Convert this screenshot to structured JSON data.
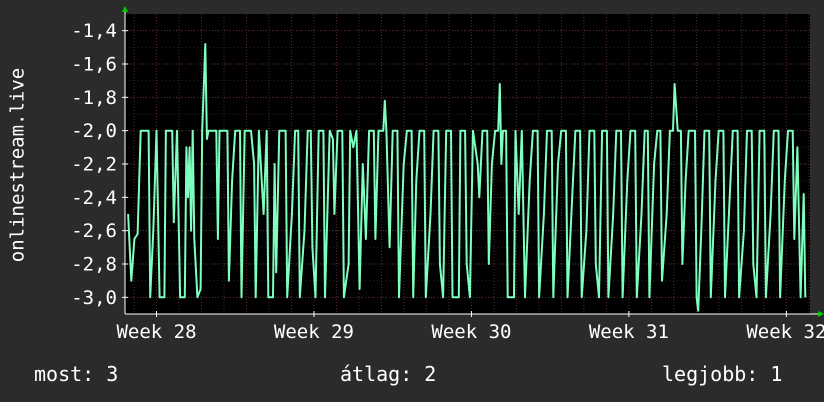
{
  "chart_data": {
    "type": "line",
    "ylabel": "onlinestream.live",
    "xlabel": "",
    "title": "",
    "y_ticks": [
      "-1,4",
      "-1,6",
      "-1,8",
      "-2,0",
      "-2,2",
      "-2,4",
      "-2,6",
      "-2,8",
      "-3,0"
    ],
    "y_tick_values": [
      -1.4,
      -1.6,
      -1.8,
      -2.0,
      -2.2,
      -2.4,
      -2.6,
      -2.8,
      -3.0
    ],
    "x_ticks": [
      "Week 28",
      "Week 29",
      "Week 30",
      "Week 31",
      "Week 32"
    ],
    "x_tick_values": [
      28,
      29,
      30,
      31,
      32
    ],
    "ylim": [
      -3.1,
      -1.3
    ],
    "xlim": [
      27.8,
      32.15
    ],
    "grid": true,
    "series": [
      {
        "color": "#7fffbf",
        "points": [
          [
            27.82,
            -2.5
          ],
          [
            27.84,
            -2.9
          ],
          [
            27.86,
            -2.65
          ],
          [
            27.88,
            -2.62
          ],
          [
            27.9,
            -2.0
          ],
          [
            27.95,
            -2.0
          ],
          [
            27.96,
            -3.0
          ],
          [
            27.98,
            -2.6
          ],
          [
            28.0,
            -2.0
          ],
          [
            28.02,
            -3.0
          ],
          [
            28.05,
            -3.0
          ],
          [
            28.06,
            -2.0
          ],
          [
            28.1,
            -2.0
          ],
          [
            28.11,
            -2.55
          ],
          [
            28.13,
            -2.0
          ],
          [
            28.15,
            -3.0
          ],
          [
            28.18,
            -3.0
          ],
          [
            28.19,
            -2.1
          ],
          [
            28.2,
            -2.4
          ],
          [
            28.21,
            -2.1
          ],
          [
            28.22,
            -2.6
          ],
          [
            28.23,
            -2.0
          ],
          [
            28.24,
            -2.65
          ],
          [
            28.26,
            -3.0
          ],
          [
            28.28,
            -2.95
          ],
          [
            28.29,
            -2.0
          ],
          [
            28.3,
            -1.75
          ],
          [
            28.31,
            -1.48
          ],
          [
            28.32,
            -2.05
          ],
          [
            28.33,
            -2.0
          ],
          [
            28.38,
            -2.0
          ],
          [
            28.39,
            -2.65
          ],
          [
            28.4,
            -2.0
          ],
          [
            28.45,
            -2.0
          ],
          [
            28.46,
            -2.9
          ],
          [
            28.48,
            -2.3
          ],
          [
            28.5,
            -2.0
          ],
          [
            28.53,
            -2.0
          ],
          [
            28.54,
            -3.0
          ],
          [
            28.56,
            -2.0
          ],
          [
            28.6,
            -2.0
          ],
          [
            28.62,
            -2.2
          ],
          [
            28.63,
            -3.0
          ],
          [
            28.65,
            -2.0
          ],
          [
            28.68,
            -2.5
          ],
          [
            28.7,
            -2.0
          ],
          [
            28.71,
            -3.0
          ],
          [
            28.74,
            -3.0
          ],
          [
            28.75,
            -2.2
          ],
          [
            28.76,
            -2.85
          ],
          [
            28.78,
            -2.0
          ],
          [
            28.82,
            -2.0
          ],
          [
            28.83,
            -3.0
          ],
          [
            28.86,
            -2.5
          ],
          [
            28.88,
            -2.0
          ],
          [
            28.9,
            -2.0
          ],
          [
            28.91,
            -3.0
          ],
          [
            28.94,
            -2.6
          ],
          [
            28.96,
            -2.0
          ],
          [
            28.98,
            -2.0
          ],
          [
            28.99,
            -2.7
          ],
          [
            29.01,
            -3.0
          ],
          [
            29.03,
            -2.0
          ],
          [
            29.06,
            -2.0
          ],
          [
            29.07,
            -3.0
          ],
          [
            29.1,
            -2.0
          ],
          [
            29.12,
            -2.05
          ],
          [
            29.13,
            -2.5
          ],
          [
            29.15,
            -2.0
          ],
          [
            29.18,
            -2.0
          ],
          [
            29.19,
            -3.0
          ],
          [
            29.22,
            -2.8
          ],
          [
            29.23,
            -2.0
          ],
          [
            29.25,
            -2.1
          ],
          [
            29.27,
            -2.0
          ],
          [
            29.29,
            -2.95
          ],
          [
            29.31,
            -2.2
          ],
          [
            29.33,
            -2.65
          ],
          [
            29.35,
            -2.0
          ],
          [
            29.38,
            -2.0
          ],
          [
            29.39,
            -2.65
          ],
          [
            29.41,
            -2.0
          ],
          [
            29.44,
            -2.0
          ],
          [
            29.45,
            -1.82
          ],
          [
            29.46,
            -2.0
          ],
          [
            29.48,
            -2.7
          ],
          [
            29.5,
            -2.0
          ],
          [
            29.53,
            -2.0
          ],
          [
            29.54,
            -3.0
          ],
          [
            29.57,
            -2.2
          ],
          [
            29.59,
            -2.0
          ],
          [
            29.62,
            -2.0
          ],
          [
            29.63,
            -3.0
          ],
          [
            29.65,
            -2.3
          ],
          [
            29.67,
            -2.0
          ],
          [
            29.7,
            -2.0
          ],
          [
            29.71,
            -3.0
          ],
          [
            29.74,
            -2.5
          ],
          [
            29.76,
            -2.0
          ],
          [
            29.79,
            -2.0
          ],
          [
            29.8,
            -2.8
          ],
          [
            29.82,
            -3.0
          ],
          [
            29.84,
            -2.0
          ],
          [
            29.87,
            -2.0
          ],
          [
            29.88,
            -3.0
          ],
          [
            29.92,
            -3.0
          ],
          [
            29.93,
            -2.0
          ],
          [
            29.96,
            -2.0
          ],
          [
            29.97,
            -2.8
          ],
          [
            29.99,
            -3.0
          ],
          [
            30.01,
            -2.0
          ],
          [
            30.04,
            -2.2
          ],
          [
            30.05,
            -2.4
          ],
          [
            30.07,
            -2.0
          ],
          [
            30.1,
            -2.0
          ],
          [
            30.11,
            -2.8
          ],
          [
            30.13,
            -2.2
          ],
          [
            30.15,
            -2.0
          ],
          [
            30.17,
            -2.0
          ],
          [
            30.18,
            -1.72
          ],
          [
            30.19,
            -2.2
          ],
          [
            30.2,
            -2.0
          ],
          [
            30.22,
            -2.0
          ],
          [
            30.23,
            -3.0
          ],
          [
            30.27,
            -3.0
          ],
          [
            30.28,
            -2.0
          ],
          [
            30.3,
            -2.5
          ],
          [
            30.32,
            -2.0
          ],
          [
            30.34,
            -3.0
          ],
          [
            30.37,
            -2.3
          ],
          [
            30.39,
            -2.0
          ],
          [
            30.42,
            -2.0
          ],
          [
            30.43,
            -3.0
          ],
          [
            30.46,
            -2.5
          ],
          [
            30.48,
            -2.0
          ],
          [
            30.51,
            -2.0
          ],
          [
            30.52,
            -3.0
          ],
          [
            30.55,
            -2.2
          ],
          [
            30.57,
            -2.0
          ],
          [
            30.6,
            -2.0
          ],
          [
            30.61,
            -3.0
          ],
          [
            30.64,
            -2.4
          ],
          [
            30.66,
            -2.0
          ],
          [
            30.69,
            -2.0
          ],
          [
            30.7,
            -3.0
          ],
          [
            30.73,
            -2.6
          ],
          [
            30.75,
            -2.0
          ],
          [
            30.78,
            -2.0
          ],
          [
            30.79,
            -2.8
          ],
          [
            30.81,
            -3.0
          ],
          [
            30.83,
            -2.0
          ],
          [
            30.86,
            -2.0
          ],
          [
            30.87,
            -3.0
          ],
          [
            30.9,
            -2.5
          ],
          [
            30.92,
            -2.0
          ],
          [
            30.95,
            -2.0
          ],
          [
            30.96,
            -3.0
          ],
          [
            30.99,
            -2.3
          ],
          [
            31.01,
            -2.0
          ],
          [
            31.04,
            -2.0
          ],
          [
            31.05,
            -3.0
          ],
          [
            31.08,
            -2.5
          ],
          [
            31.1,
            -2.0
          ],
          [
            31.12,
            -2.0
          ],
          [
            31.13,
            -3.0
          ],
          [
            31.16,
            -2.2
          ],
          [
            31.18,
            -2.0
          ],
          [
            31.2,
            -2.0
          ],
          [
            31.21,
            -2.9
          ],
          [
            31.24,
            -2.5
          ],
          [
            31.26,
            -2.0
          ],
          [
            31.28,
            -2.0
          ],
          [
            31.29,
            -1.72
          ],
          [
            31.31,
            -2.0
          ],
          [
            31.33,
            -2.0
          ],
          [
            31.34,
            -2.8
          ],
          [
            31.36,
            -2.3
          ],
          [
            31.38,
            -2.0
          ],
          [
            31.42,
            -2.0
          ],
          [
            31.43,
            -3.0
          ],
          [
            31.44,
            -3.08
          ],
          [
            31.46,
            -2.6
          ],
          [
            31.48,
            -2.0
          ],
          [
            31.51,
            -2.0
          ],
          [
            31.52,
            -3.0
          ],
          [
            31.55,
            -2.3
          ],
          [
            31.57,
            -2.0
          ],
          [
            31.6,
            -2.0
          ],
          [
            31.61,
            -3.0
          ],
          [
            31.64,
            -2.4
          ],
          [
            31.66,
            -2.0
          ],
          [
            31.69,
            -2.0
          ],
          [
            31.7,
            -3.0
          ],
          [
            31.73,
            -2.6
          ],
          [
            31.75,
            -2.0
          ],
          [
            31.78,
            -2.0
          ],
          [
            31.79,
            -2.8
          ],
          [
            31.81,
            -3.0
          ],
          [
            31.83,
            -2.0
          ],
          [
            31.86,
            -2.0
          ],
          [
            31.87,
            -3.0
          ],
          [
            31.9,
            -2.5
          ],
          [
            31.92,
            -2.0
          ],
          [
            31.95,
            -2.0
          ],
          [
            31.96,
            -3.0
          ],
          [
            31.99,
            -2.3
          ],
          [
            32.01,
            -2.0
          ],
          [
            32.04,
            -2.0
          ],
          [
            32.05,
            -2.65
          ],
          [
            32.07,
            -2.1
          ],
          [
            32.09,
            -3.0
          ],
          [
            32.11,
            -2.38
          ],
          [
            32.12,
            -3.0
          ]
        ]
      }
    ]
  },
  "footer": {
    "current": "most: 3",
    "average": "átlag: 2",
    "best": "legjobb: 1"
  },
  "colors": {
    "background": "#2b2b2b",
    "plot_background": "#000000",
    "grid": "#5a2a2a",
    "axis": "#ffffff",
    "arrow": "#00cc00",
    "line": "#7fffbf"
  }
}
